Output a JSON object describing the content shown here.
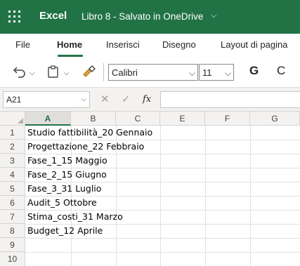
{
  "titlebar": {
    "app_name": "Excel",
    "doc_title": "Libro 8  -  Salvato in OneDrive",
    "chevron": "⌵"
  },
  "tabs": [
    {
      "label": "File"
    },
    {
      "label": "Home"
    },
    {
      "label": "Inserisci"
    },
    {
      "label": "Disegno"
    },
    {
      "label": "Layout di pagina"
    }
  ],
  "toolbar": {
    "font_name": "Calibri",
    "font_size": "11",
    "grow_label": "G",
    "shrink_label": "C",
    "dropdown_glyph": "⌵"
  },
  "formula_bar": {
    "name_box": "A21",
    "cancel_glyph": "✕",
    "enter_glyph": "✓",
    "fx_label": "fx",
    "formula_value": ""
  },
  "grid": {
    "columns": [
      "A",
      "B",
      "C",
      "E",
      "F",
      "G"
    ],
    "rows": [
      "1",
      "2",
      "3",
      "4",
      "5",
      "6",
      "7",
      "8",
      "9",
      "10"
    ],
    "selected_column": "A",
    "cells": [
      "Studio fattibilità_20 Gennaio",
      "Progettazione_22 Febbraio",
      "Fase_1_15 Maggio",
      "Fase_2_15 Giugno",
      "Fase_3_31 Luglio",
      "Audit_5 Ottobre",
      "Stima_costi_31 Marzo",
      "Budget_12 Aprile"
    ]
  },
  "colors": {
    "brand": "#217346",
    "ribbon_bg": "#ffffff",
    "header_bg": "#f3f2f1"
  },
  "icons": [
    "app-launcher-icon",
    "undo-icon",
    "paste-icon",
    "format-painter-icon",
    "chevron-down-icon"
  ]
}
